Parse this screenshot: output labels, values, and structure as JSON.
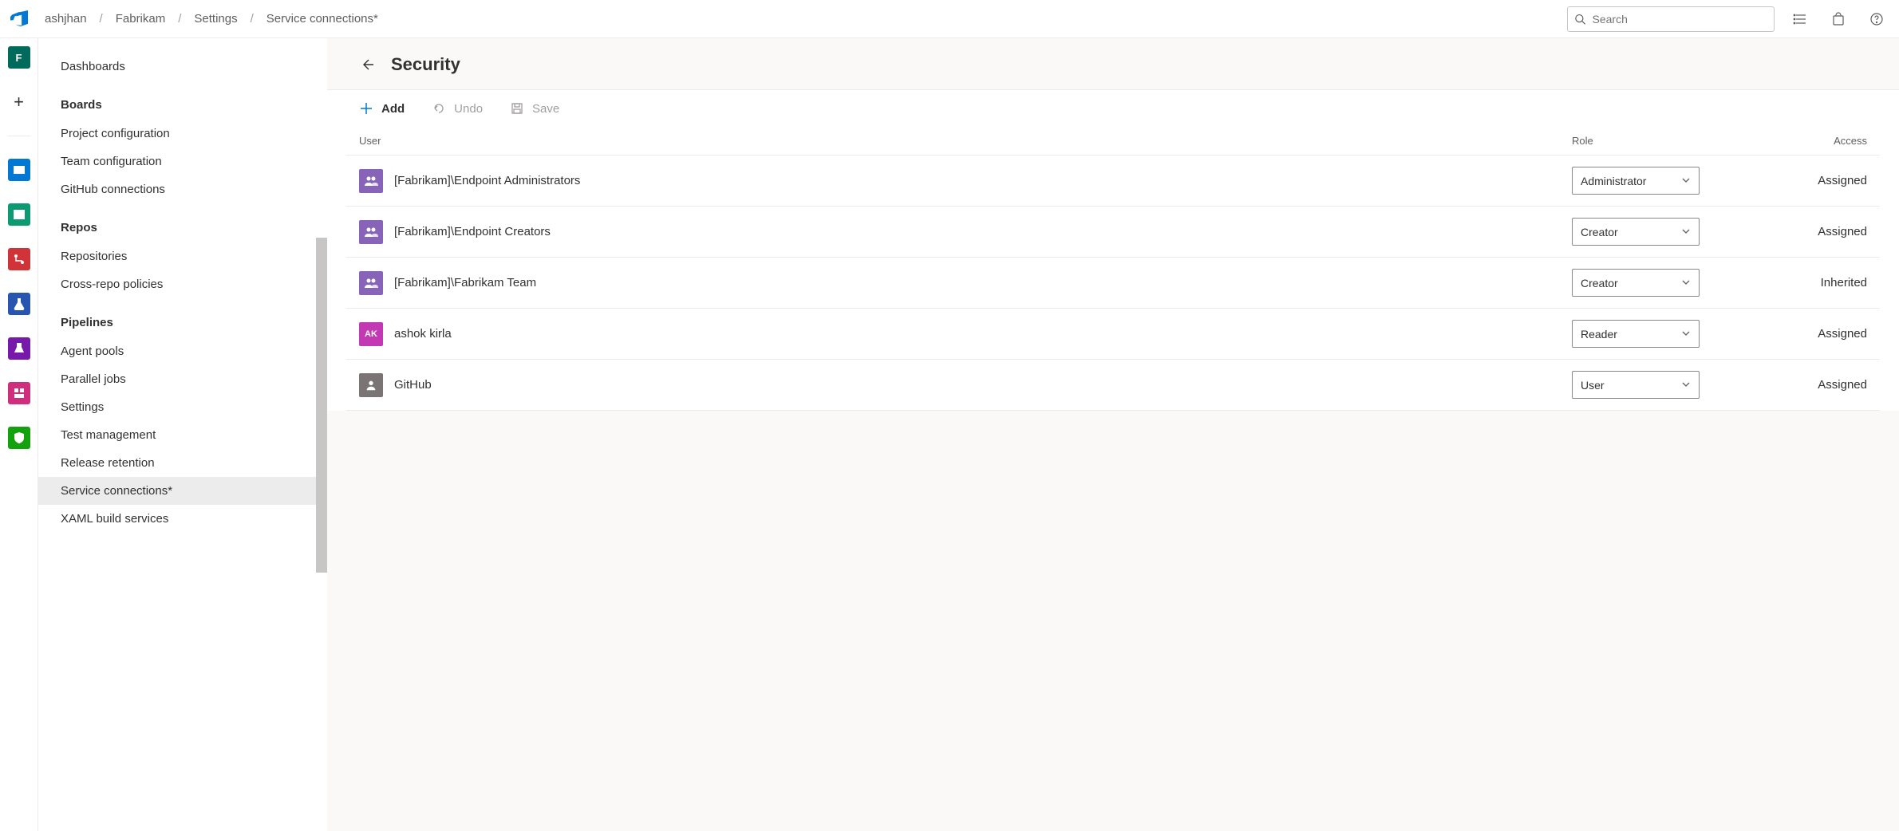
{
  "breadcrumb": [
    "ashjhan",
    "Fabrikam",
    "Settings",
    "Service connections*"
  ],
  "search": {
    "placeholder": "Search"
  },
  "sidebar": {
    "groups": [
      {
        "header": null,
        "items": [
          "Dashboards"
        ]
      },
      {
        "header": "Boards",
        "items": [
          "Project configuration",
          "Team configuration",
          "GitHub connections"
        ]
      },
      {
        "header": "Repos",
        "items": [
          "Repositories",
          "Cross-repo policies"
        ]
      },
      {
        "header": "Pipelines",
        "items": [
          "Agent pools",
          "Parallel jobs",
          "Settings",
          "Test management",
          "Release retention",
          "Service connections*",
          "XAML build services"
        ]
      }
    ],
    "active": "Service connections*"
  },
  "panel": {
    "title": "Security",
    "toolbar": {
      "add": "Add",
      "undo": "Undo",
      "save": "Save"
    },
    "columns": {
      "user": "User",
      "role": "Role",
      "access": "Access"
    },
    "rows": [
      {
        "user": "[Fabrikam]\\Endpoint Administrators",
        "avatar": "group",
        "role": "Administrator",
        "access": "Assigned"
      },
      {
        "user": "[Fabrikam]\\Endpoint Creators",
        "avatar": "group",
        "role": "Creator",
        "access": "Assigned"
      },
      {
        "user": "[Fabrikam]\\Fabrikam Team",
        "avatar": "group",
        "role": "Creator",
        "access": "Inherited"
      },
      {
        "user": "ashok kirla",
        "avatar": "ak",
        "initials": "AK",
        "role": "Reader",
        "access": "Assigned"
      },
      {
        "user": "GitHub",
        "avatar": "svc",
        "role": "User",
        "access": "Assigned"
      }
    ]
  }
}
